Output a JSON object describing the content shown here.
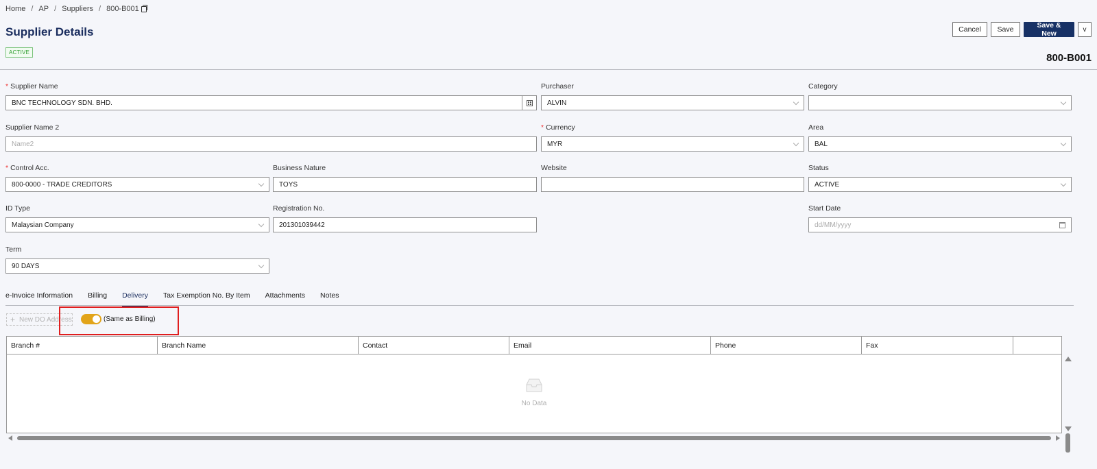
{
  "breadcrumb": {
    "items": [
      "Home",
      "AP",
      "Suppliers",
      "800-B001"
    ],
    "separator": "/"
  },
  "header": {
    "title": "Supplier Details",
    "status": "ACTIVE",
    "code": "800-B001"
  },
  "actions": {
    "cancel": "Cancel",
    "save": "Save",
    "save_new": "Save & New",
    "more": "v"
  },
  "form": {
    "supplier_name": {
      "label": "Supplier Name",
      "value": "BNC TECHNOLOGY SDN. BHD."
    },
    "purchaser": {
      "label": "Purchaser",
      "value": "ALVIN"
    },
    "category": {
      "label": "Category",
      "value": ""
    },
    "supplier_name_2": {
      "label": "Supplier Name 2",
      "value": "",
      "placeholder": "Name2"
    },
    "currency": {
      "label": "Currency",
      "value": "MYR"
    },
    "area": {
      "label": "Area",
      "value": "BAL"
    },
    "control_acc": {
      "label": "Control Acc.",
      "value": "800-0000 - TRADE CREDITORS"
    },
    "business_nature": {
      "label": "Business Nature",
      "value": "TOYS"
    },
    "website": {
      "label": "Website",
      "value": ""
    },
    "status": {
      "label": "Status",
      "value": "ACTIVE"
    },
    "id_type": {
      "label": "ID Type",
      "value": "Malaysian Company"
    },
    "registration_no": {
      "label": "Registration No.",
      "value": "201301039442"
    },
    "start_date": {
      "label": "Start Date",
      "value": "",
      "placeholder": "dd/MM/yyyy"
    },
    "term": {
      "label": "Term",
      "value": "90 DAYS"
    }
  },
  "tabs": [
    {
      "label": "e-Invoice Information"
    },
    {
      "label": "Billing"
    },
    {
      "label": "Delivery"
    },
    {
      "label": "Tax Exemption No. By Item"
    },
    {
      "label": "Attachments"
    },
    {
      "label": "Notes"
    }
  ],
  "delivery": {
    "new_address_label": "New DO Address",
    "toggle_label": "(Same as Billing)",
    "toggle_on": true,
    "columns": [
      "Branch #",
      "Branch Name",
      "Contact",
      "Email",
      "Phone",
      "Fax",
      ""
    ],
    "empty_text": "No Data"
  },
  "colors": {
    "primary": "#173165",
    "title": "#1a2d5e",
    "toggle_on": "#e2a419",
    "required": "#ee3333",
    "highlight": "#e01e1e",
    "active_badge": "#2f9d2f"
  }
}
